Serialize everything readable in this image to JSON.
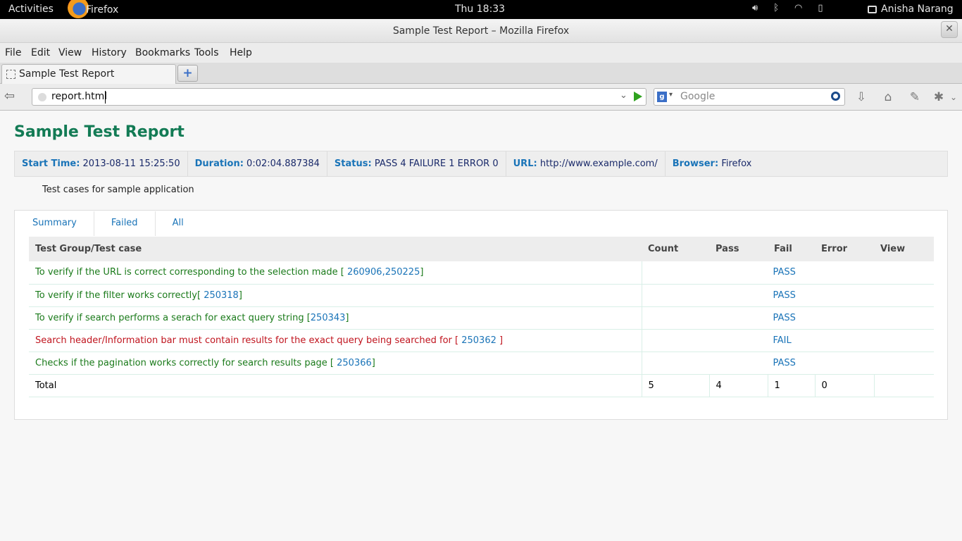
{
  "topbar": {
    "activities": "Activities",
    "app_name": "Firefox",
    "clock": "Thu 18:33",
    "user": "Anisha Narang",
    "icons": [
      "volume-icon",
      "bluetooth-icon",
      "wifi-icon",
      "battery-icon",
      "user-icon"
    ]
  },
  "window": {
    "title": "Sample Test Report – Mozilla Firefox",
    "close": "✕"
  },
  "menu": [
    "File",
    "Edit",
    "View",
    "History",
    "Bookmarks",
    "Tools",
    "Help"
  ],
  "tab": {
    "title": "Sample Test Report",
    "new_tab": "+"
  },
  "nav": {
    "url": "report.html",
    "search_placeholder": "Google"
  },
  "report": {
    "title": "Sample Test Report",
    "attributes": [
      {
        "key": "Start Time:",
        "value": "2013-08-11 15:25:50"
      },
      {
        "key": "Duration:",
        "value": "0:02:04.887384"
      },
      {
        "key": "Status:",
        "value": "PASS 4 FAILURE 1 ERROR 0"
      },
      {
        "key": "URL:",
        "value": "http://www.example.com/"
      },
      {
        "key": "Browser:",
        "value": "Firefox"
      }
    ],
    "description": "Test cases for sample application",
    "tabs": [
      "Summary",
      "Failed",
      "All"
    ],
    "columns": [
      "Test Group/Test case",
      "Count",
      "Pass",
      "Fail",
      "Error",
      "View"
    ],
    "rows": [
      {
        "text": "To verify if the URL is correct corresponding to the selection made [ ",
        "ids": [
          "260906",
          "250225"
        ],
        "suffix": "]",
        "status": "PASS",
        "result": "pass"
      },
      {
        "text": "To verify if the filter works correctly[ ",
        "ids": [
          "250318"
        ],
        "suffix": "]",
        "status": "PASS",
        "result": "pass"
      },
      {
        "text": "To verify if search performs a serach for exact query string [",
        "ids": [
          "250343"
        ],
        "suffix": "]",
        "status": "PASS",
        "result": "pass"
      },
      {
        "text": "Search header/Information bar must contain results for the exact query being searched for [ ",
        "ids": [
          "250362 "
        ],
        "suffix": "]",
        "status": "FAIL",
        "result": "fail"
      },
      {
        "text": "Checks if the pagination works correctly for search results page [ ",
        "ids": [
          "250366"
        ],
        "suffix": "]",
        "status": "PASS",
        "result": "pass"
      }
    ],
    "total": {
      "label": "Total",
      "count": "5",
      "pass": "4",
      "fail": "1",
      "error": "0",
      "view": ""
    }
  }
}
